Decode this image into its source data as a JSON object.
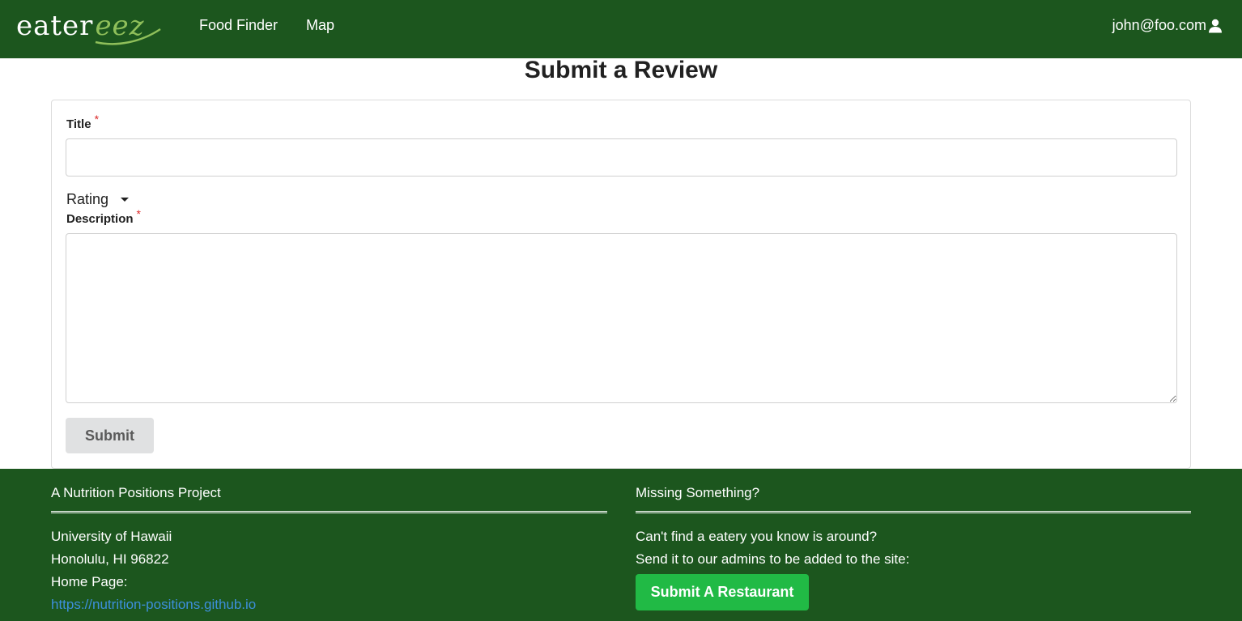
{
  "navbar": {
    "brand_primary": "eater",
    "brand_secondary": "eez",
    "links": [
      "Food Finder",
      "Map"
    ],
    "user_email": "john@foo.com",
    "user_icon": "user-icon"
  },
  "page": {
    "title": "Submit a Review"
  },
  "form": {
    "title_label": "Title",
    "title_value": "",
    "required_mark": "*",
    "rating_label": "Rating",
    "description_label": "Description",
    "description_value": "",
    "submit_label": "Submit"
  },
  "footer": {
    "left": {
      "heading": "A Nutrition Positions Project",
      "lines": [
        "University of Hawaii",
        "Honolulu, HI 96822",
        "Home Page:"
      ],
      "link": "https://nutrition-positions.github.io"
    },
    "right": {
      "heading": "Missing Something?",
      "lines": [
        "Can't find a eatery you know is around?",
        "Send it to our admins to be added to the site:"
      ],
      "button_label": "Submit A Restaurant"
    }
  },
  "colors": {
    "nav_background": "#1c561e",
    "footer_background": "#1c561e",
    "brand_accent": "#8fbf5a",
    "submit_restaurant_button": "#21ba45",
    "link": "#3d8fdc",
    "required": "#db2828"
  }
}
